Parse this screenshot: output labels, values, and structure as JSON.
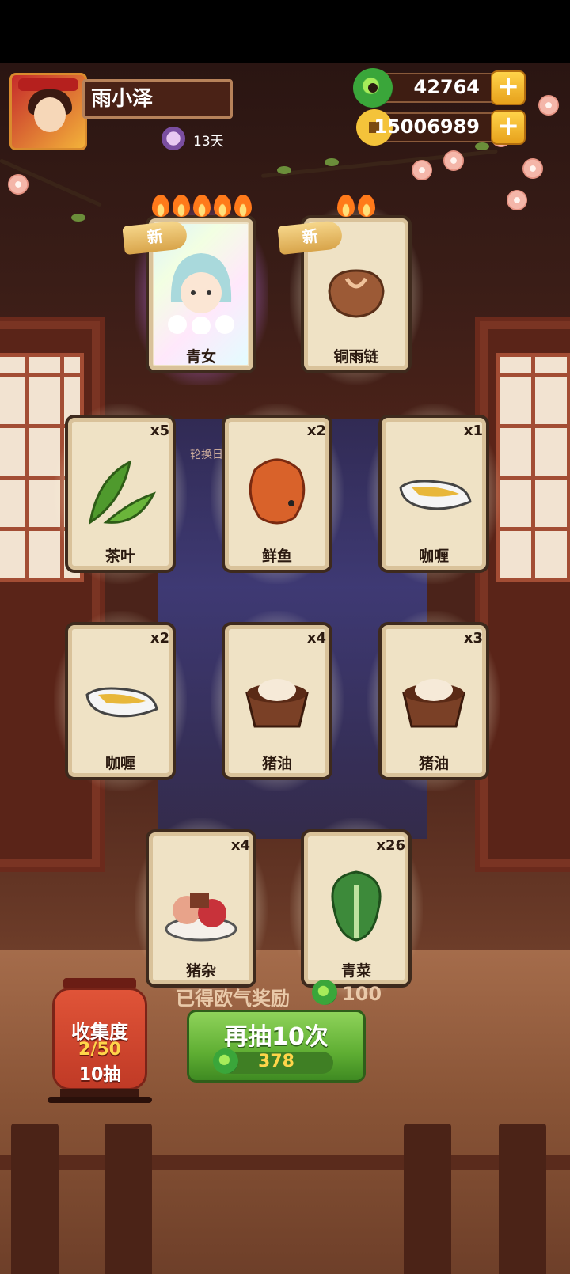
{
  "player": {
    "name": "雨小泽",
    "days": "13天"
  },
  "resources": {
    "jade": "42764",
    "coins": "15006989",
    "plus": "+"
  },
  "background": {
    "calendar_label": "轮换日历"
  },
  "cards": [
    {
      "name": "青女",
      "count": "",
      "is_new": true,
      "new_label": "新",
      "flames": 5
    },
    {
      "name": "铜雨链",
      "count": "",
      "is_new": true,
      "new_label": "新",
      "flames": 2
    },
    {
      "name": "茶叶",
      "count": "x5"
    },
    {
      "name": "鲜鱼",
      "count": "x2"
    },
    {
      "name": "咖喱",
      "count": "x1"
    },
    {
      "name": "咖喱",
      "count": "x2"
    },
    {
      "name": "猪油",
      "count": "x4"
    },
    {
      "name": "猪油",
      "count": "x3"
    },
    {
      "name": "猪杂",
      "count": "x4"
    },
    {
      "name": "青菜",
      "count": "x26"
    }
  ],
  "reward": {
    "label": "已得欧气奖励",
    "value": "100"
  },
  "collection": {
    "title": "收集度",
    "progress": "2/50",
    "draws": "10抽"
  },
  "draw_button": {
    "label": "再抽10次",
    "cost": "378"
  },
  "icons": {
    "jade": "green-jade-icon",
    "coin": "copper-coin-icon",
    "days": "purple-avatar-icon",
    "flame": "flame-icon"
  }
}
